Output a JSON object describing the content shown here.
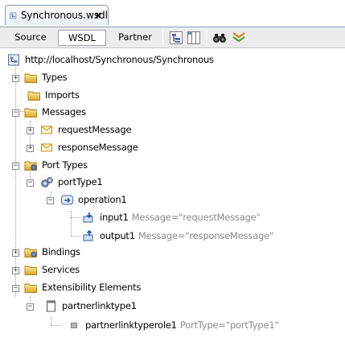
{
  "tab": {
    "title": "Synchronous.wsdl",
    "close_label": "×"
  },
  "toolbar": {
    "source_label": "Source",
    "wsdl_label": "WSDL",
    "partner_label": "Partner"
  },
  "tree": {
    "root_url": "http://localhost/Synchronous/Synchronous",
    "types": "Types",
    "imports": "Imports",
    "messages": "Messages",
    "request_message": "requestMessage",
    "response_message": "responseMessage",
    "port_types": "Port Types",
    "port_type1": "portType1",
    "operation1": "operation1",
    "input1": "input1",
    "input1_attr": "Message=\"requestMessage\"",
    "output1": "output1",
    "output1_attr": "Message=\"responseMessage\"",
    "bindings": "Bindings",
    "services": "Services",
    "extensibility": "Extensibility Elements",
    "partnerlinktype1": "partnerlinktype1",
    "partnerlinktyperole1": "partnerlinktyperole1",
    "role_attr": "PortType=\"portType1\""
  },
  "expander": {
    "plus": "+",
    "minus": "−"
  },
  "colors": {
    "folder": "#e8c24a",
    "selected_tab": "#ffffff",
    "attr_text": "#8a8a8a"
  }
}
